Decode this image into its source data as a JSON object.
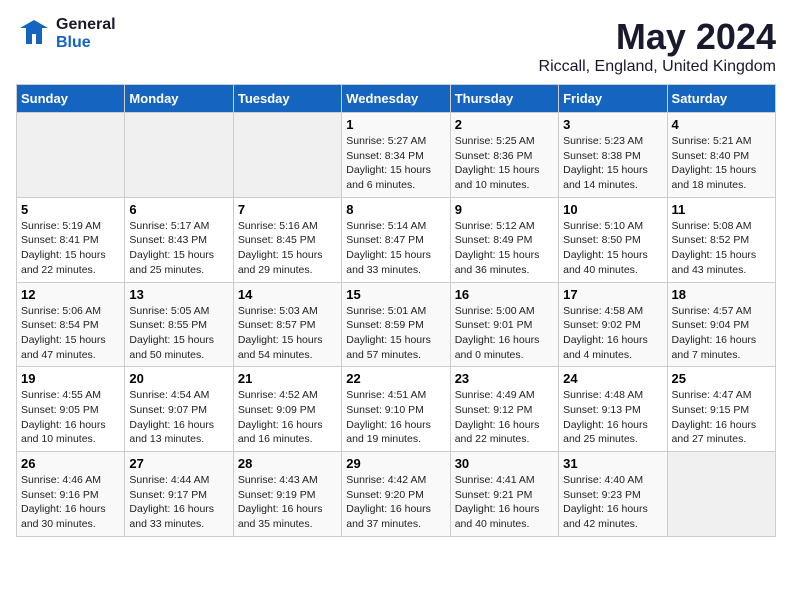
{
  "logo": {
    "general": "General",
    "blue": "Blue"
  },
  "title": "May 2024",
  "subtitle": "Riccall, England, United Kingdom",
  "days_of_week": [
    "Sunday",
    "Monday",
    "Tuesday",
    "Wednesday",
    "Thursday",
    "Friday",
    "Saturday"
  ],
  "weeks": [
    [
      {
        "day": "",
        "info": ""
      },
      {
        "day": "",
        "info": ""
      },
      {
        "day": "",
        "info": ""
      },
      {
        "day": "1",
        "info": "Sunrise: 5:27 AM\nSunset: 8:34 PM\nDaylight: 15 hours\nand 6 minutes."
      },
      {
        "day": "2",
        "info": "Sunrise: 5:25 AM\nSunset: 8:36 PM\nDaylight: 15 hours\nand 10 minutes."
      },
      {
        "day": "3",
        "info": "Sunrise: 5:23 AM\nSunset: 8:38 PM\nDaylight: 15 hours\nand 14 minutes."
      },
      {
        "day": "4",
        "info": "Sunrise: 5:21 AM\nSunset: 8:40 PM\nDaylight: 15 hours\nand 18 minutes."
      }
    ],
    [
      {
        "day": "5",
        "info": "Sunrise: 5:19 AM\nSunset: 8:41 PM\nDaylight: 15 hours\nand 22 minutes."
      },
      {
        "day": "6",
        "info": "Sunrise: 5:17 AM\nSunset: 8:43 PM\nDaylight: 15 hours\nand 25 minutes."
      },
      {
        "day": "7",
        "info": "Sunrise: 5:16 AM\nSunset: 8:45 PM\nDaylight: 15 hours\nand 29 minutes."
      },
      {
        "day": "8",
        "info": "Sunrise: 5:14 AM\nSunset: 8:47 PM\nDaylight: 15 hours\nand 33 minutes."
      },
      {
        "day": "9",
        "info": "Sunrise: 5:12 AM\nSunset: 8:49 PM\nDaylight: 15 hours\nand 36 minutes."
      },
      {
        "day": "10",
        "info": "Sunrise: 5:10 AM\nSunset: 8:50 PM\nDaylight: 15 hours\nand 40 minutes."
      },
      {
        "day": "11",
        "info": "Sunrise: 5:08 AM\nSunset: 8:52 PM\nDaylight: 15 hours\nand 43 minutes."
      }
    ],
    [
      {
        "day": "12",
        "info": "Sunrise: 5:06 AM\nSunset: 8:54 PM\nDaylight: 15 hours\nand 47 minutes."
      },
      {
        "day": "13",
        "info": "Sunrise: 5:05 AM\nSunset: 8:55 PM\nDaylight: 15 hours\nand 50 minutes."
      },
      {
        "day": "14",
        "info": "Sunrise: 5:03 AM\nSunset: 8:57 PM\nDaylight: 15 hours\nand 54 minutes."
      },
      {
        "day": "15",
        "info": "Sunrise: 5:01 AM\nSunset: 8:59 PM\nDaylight: 15 hours\nand 57 minutes."
      },
      {
        "day": "16",
        "info": "Sunrise: 5:00 AM\nSunset: 9:01 PM\nDaylight: 16 hours\nand 0 minutes."
      },
      {
        "day": "17",
        "info": "Sunrise: 4:58 AM\nSunset: 9:02 PM\nDaylight: 16 hours\nand 4 minutes."
      },
      {
        "day": "18",
        "info": "Sunrise: 4:57 AM\nSunset: 9:04 PM\nDaylight: 16 hours\nand 7 minutes."
      }
    ],
    [
      {
        "day": "19",
        "info": "Sunrise: 4:55 AM\nSunset: 9:05 PM\nDaylight: 16 hours\nand 10 minutes."
      },
      {
        "day": "20",
        "info": "Sunrise: 4:54 AM\nSunset: 9:07 PM\nDaylight: 16 hours\nand 13 minutes."
      },
      {
        "day": "21",
        "info": "Sunrise: 4:52 AM\nSunset: 9:09 PM\nDaylight: 16 hours\nand 16 minutes."
      },
      {
        "day": "22",
        "info": "Sunrise: 4:51 AM\nSunset: 9:10 PM\nDaylight: 16 hours\nand 19 minutes."
      },
      {
        "day": "23",
        "info": "Sunrise: 4:49 AM\nSunset: 9:12 PM\nDaylight: 16 hours\nand 22 minutes."
      },
      {
        "day": "24",
        "info": "Sunrise: 4:48 AM\nSunset: 9:13 PM\nDaylight: 16 hours\nand 25 minutes."
      },
      {
        "day": "25",
        "info": "Sunrise: 4:47 AM\nSunset: 9:15 PM\nDaylight: 16 hours\nand 27 minutes."
      }
    ],
    [
      {
        "day": "26",
        "info": "Sunrise: 4:46 AM\nSunset: 9:16 PM\nDaylight: 16 hours\nand 30 minutes."
      },
      {
        "day": "27",
        "info": "Sunrise: 4:44 AM\nSunset: 9:17 PM\nDaylight: 16 hours\nand 33 minutes."
      },
      {
        "day": "28",
        "info": "Sunrise: 4:43 AM\nSunset: 9:19 PM\nDaylight: 16 hours\nand 35 minutes."
      },
      {
        "day": "29",
        "info": "Sunrise: 4:42 AM\nSunset: 9:20 PM\nDaylight: 16 hours\nand 37 minutes."
      },
      {
        "day": "30",
        "info": "Sunrise: 4:41 AM\nSunset: 9:21 PM\nDaylight: 16 hours\nand 40 minutes."
      },
      {
        "day": "31",
        "info": "Sunrise: 4:40 AM\nSunset: 9:23 PM\nDaylight: 16 hours\nand 42 minutes."
      },
      {
        "day": "",
        "info": ""
      }
    ]
  ]
}
